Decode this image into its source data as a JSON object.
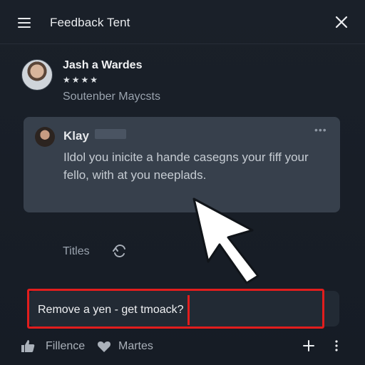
{
  "header": {
    "title": "Feedback Tent",
    "menu_icon": "hamburger-menu-icon",
    "close_icon": "close-icon"
  },
  "profile": {
    "name": "Jash a Wardes",
    "rating_stars": "★★★★",
    "rating": 4,
    "subtitle": "Soutenber Maycsts"
  },
  "message_card": {
    "author": "Klay",
    "more_icon": "more-horizontal-icon",
    "text": "Ildol you inicite a hande casegns your fiff your fello, with at you neeplads."
  },
  "tags_row": {
    "label": "Titles",
    "refresh_icon": "refresh-icon"
  },
  "input": {
    "value": "Remove a yen - get tmoack?"
  },
  "footer": {
    "like_label": "Fillence",
    "heart_label": "Martes",
    "like_icon": "thumbs-up-icon",
    "heart_icon": "heart-icon",
    "plus_icon": "plus-icon",
    "kebab_icon": "more-vertical-icon"
  },
  "colors": {
    "background": "#161c25",
    "card": "#37404c",
    "highlight": "#e21d1d"
  }
}
